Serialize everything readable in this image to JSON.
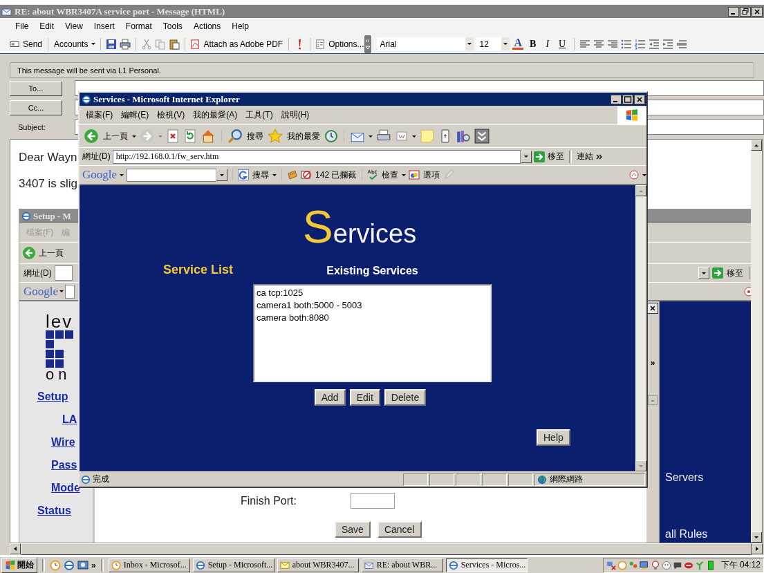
{
  "outlook": {
    "title": "RE: about WBR3407A service port - Message (HTML)",
    "menu": [
      "File",
      "Edit",
      "View",
      "Insert",
      "Format",
      "Tools",
      "Actions",
      "Help"
    ],
    "toolbar": {
      "send": "Send",
      "accounts": "Accounts",
      "attach_pdf": "Attach as Adobe PDF",
      "options": "Options...",
      "font": "Arial",
      "size": "12",
      "font_color": "A",
      "format": [
        "B",
        "I",
        "U"
      ]
    },
    "info": "This message will be sent via L1 Personal.",
    "fields": [
      {
        "kind": "button",
        "label": "To..."
      },
      {
        "kind": "button",
        "label": "Cc..."
      },
      {
        "kind": "label",
        "label": "Subject:"
      }
    ],
    "body": [
      "Dear Wayn",
      "3407 is slig"
    ]
  },
  "setup_window": {
    "title": "Setup - M",
    "menu": [
      "檔案(F)",
      "編"
    ],
    "back": "上一頁",
    "address_label": "網址(D)",
    "go": "移至",
    "google": "Google",
    "logo_top": "lev",
    "logo_bottom": "on",
    "nav": [
      "Setup",
      "LA",
      "Wire",
      "Pass",
      "Mode",
      "Status"
    ],
    "side_chevron": "»",
    "finish_port_label": "Finish Port:",
    "buttons": [
      "Save",
      "Cancel"
    ],
    "side_links": [
      "Servers",
      "all Rules"
    ]
  },
  "ie": {
    "title": "Services - Microsoft Internet Explorer",
    "menu": [
      "檔案(F)",
      "編輯(E)",
      "檢視(V)",
      "我的最愛(A)",
      "工具(T)",
      "說明(H)"
    ],
    "toolbar": {
      "back": "上一頁",
      "search": "搜尋",
      "favorites": "我的最愛"
    },
    "address_label": "網址(D)",
    "url": "http://192.168.0.1/fw_serv.htm",
    "go": "移至",
    "links": "連結",
    "google": {
      "logo": "Google",
      "search": "搜尋",
      "blocked": "142 已攔截",
      "check": "檢查",
      "options": "選項"
    },
    "page": {
      "heading_initial": "S",
      "heading_rest": "ervices",
      "service_list": "Service List",
      "existing": "Existing Services",
      "services": [
        "ca tcp:1025",
        "camera1 both:5000 - 5003",
        "camera both:8080"
      ],
      "buttons": [
        "Add",
        "Edit",
        "Delete"
      ],
      "help": "Help"
    },
    "status": "完成",
    "zone": "網際網路"
  },
  "taskbar": {
    "start": "開始",
    "more": "»",
    "tasks": [
      {
        "label": "Inbox - Microsof...",
        "selected": false
      },
      {
        "label": "Setup - Microsoft...",
        "selected": false
      },
      {
        "label": "about WBR3407...",
        "selected": false
      },
      {
        "label": "RE: about WBR...",
        "selected": false
      },
      {
        "label": "Services - Micros...",
        "selected": true
      }
    ],
    "clock": "下午 04:12"
  }
}
